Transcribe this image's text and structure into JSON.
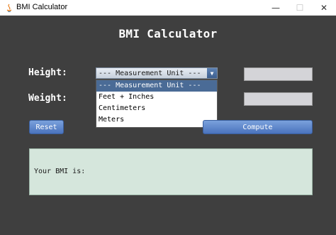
{
  "window": {
    "title": "BMI Calculator",
    "controls": {
      "minimize": "—",
      "maximize": "☐",
      "close": "✕"
    }
  },
  "heading": "BMI Calculator",
  "form": {
    "height_label": "Height:",
    "weight_label": "Weight:",
    "unit_select": {
      "selected": "--- Measurement Unit ---",
      "options": [
        "--- Measurement Unit ---",
        "Feet + Inches",
        "Centimeters",
        "Meters"
      ],
      "highlighted_index": 0
    },
    "height_value": "",
    "weight_value": ""
  },
  "buttons": {
    "reset": "Reset",
    "compute": "Compute"
  },
  "result": {
    "label": "Your BMI is:"
  },
  "colors": {
    "background": "#3f3f3f",
    "result_panel": "#d5e6dc",
    "button": "#5a82c8",
    "selection": "#4a6b96"
  }
}
